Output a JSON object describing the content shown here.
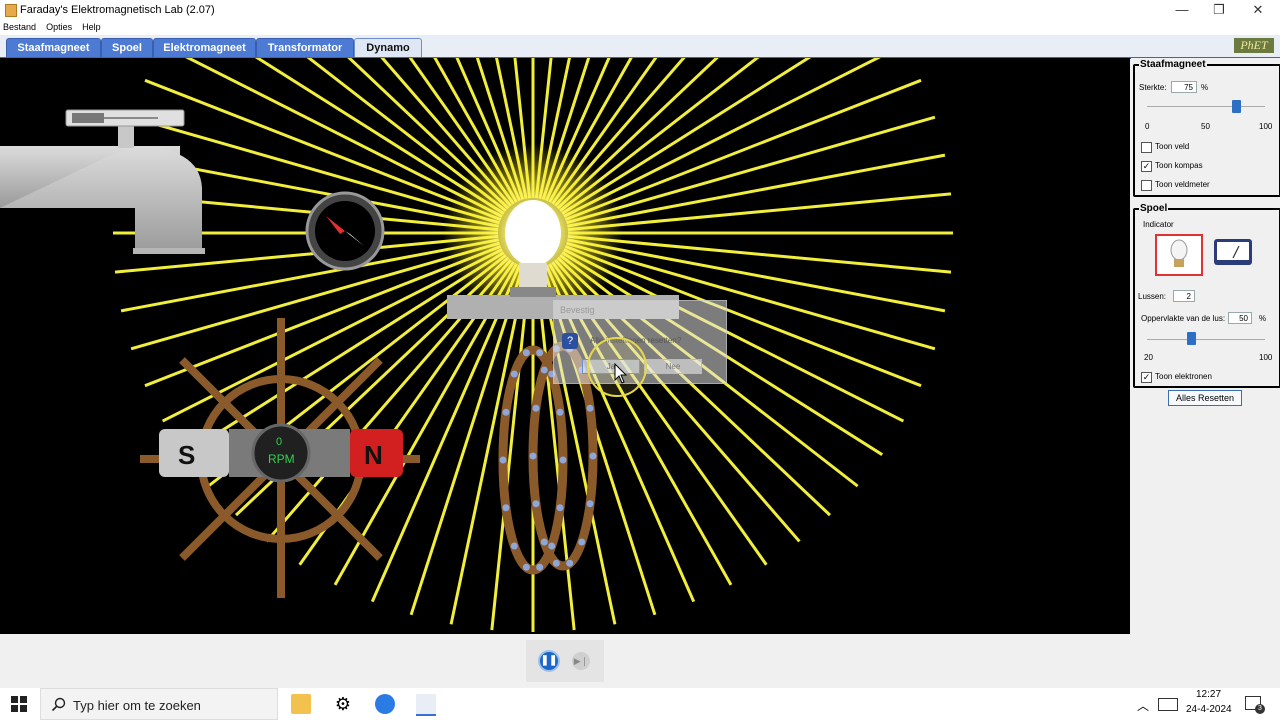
{
  "window": {
    "title": "Faraday's Elektromagnetisch Lab (2.07)",
    "minimize": "—",
    "restore": "❐",
    "close": "✕"
  },
  "menu": [
    "Bestand",
    "Opties",
    "Help"
  ],
  "tabs": [
    {
      "label": "Staafmagneet"
    },
    {
      "label": "Spoel"
    },
    {
      "label": "Elektromagneet"
    },
    {
      "label": "Transformator"
    },
    {
      "label": "Dynamo",
      "active": true
    }
  ],
  "logo": "PhET",
  "scene": {
    "magnet_s": "S",
    "magnet_n": "N",
    "rpm_value": "0",
    "rpm_unit": "RPM",
    "dialog": {
      "title": "Bevestig",
      "message": "Alle instellingen resetten?",
      "yes": "Ja",
      "no": "Nee"
    }
  },
  "panel": {
    "staafmagneet": {
      "title": "Staafmagneet",
      "sterkte_label": "Sterkte:",
      "sterkte_value": "75",
      "percent": "%",
      "ticks": [
        "0",
        "50",
        "100"
      ],
      "slider_level": 75,
      "checkboxes": [
        {
          "label": "Toon veld",
          "checked": false
        },
        {
          "label": "Toon kompas",
          "checked": true
        },
        {
          "label": "Toon veldmeter",
          "checked": false
        }
      ]
    },
    "spoel": {
      "title": "Spoel",
      "indicator_label": "Indicator",
      "lussen_label": "Lussen:",
      "lussen_value": "2",
      "area_label": "Oppervlakte van de lus:",
      "area_value": "50",
      "percent": "%",
      "area_ticks": [
        "20",
        "100"
      ],
      "area_level": 50,
      "toon_elektronen": {
        "label": "Toon elektronen",
        "checked": true
      }
    },
    "reset_button": "Alles Resetten"
  },
  "taskbar": {
    "search_placeholder": "Typ hier om te zoeken",
    "time": "12:27",
    "date": "24-4-2024",
    "notifications": "3"
  }
}
